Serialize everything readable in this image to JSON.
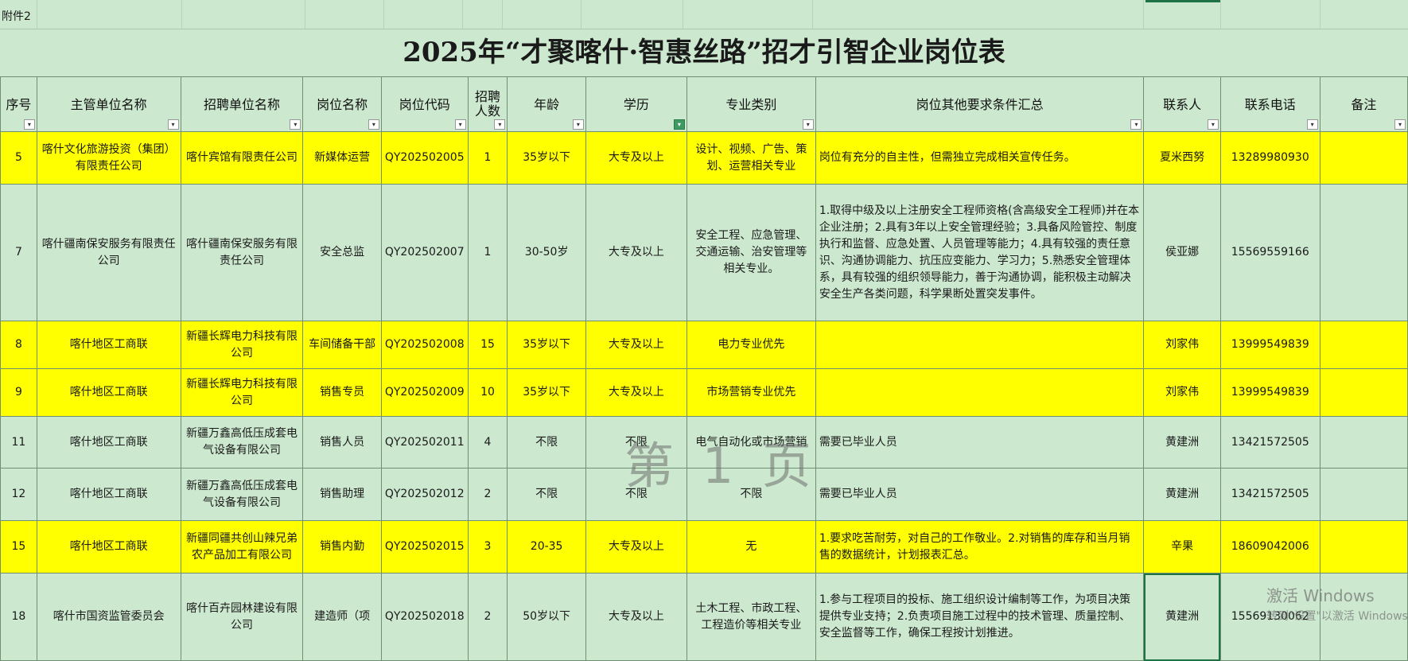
{
  "sheet": {
    "attachment_label": "附件2",
    "title": "2025年“才聚喀什·智惠丝路”招才引智企业岗位表"
  },
  "columns": [
    "序号",
    "主管单位名称",
    "招聘单位名称",
    "岗位名称",
    "岗位代码",
    "招聘人数",
    "年龄",
    "学历",
    "专业类别",
    "岗位其他要求条件汇总",
    "联系人",
    "联系电话",
    "备注"
  ],
  "rows": [
    {
      "no": "5",
      "org": "喀什文化旅游投资（集团）有限责任公司",
      "unit": "喀什宾馆有限责任公司",
      "post": "新媒体运营",
      "code": "QY202502005",
      "count": "1",
      "age": "35岁以下",
      "edu": "大专及以上",
      "major": "设计、视频、广告、策划、运营相关专业",
      "req": "岗位有充分的自主性，但需独立完成相关宣传任务。",
      "contact": "夏米西努",
      "phone": "13289980930",
      "note": ""
    },
    {
      "no": "7",
      "org": "喀什疆南保安服务有限责任公司",
      "unit": "喀什疆南保安服务有限责任公司",
      "post": "安全总监",
      "code": "QY202502007",
      "count": "1",
      "age": "30-50岁",
      "edu": "大专及以上",
      "major": "安全工程、应急管理、交通运输、治安管理等相关专业。",
      "req": "1.取得中级及以上注册安全工程师资格(含高级安全工程师)并在本企业注册；2.具有3年以上安全管理经验；3.具备风险管控、制度执行和监督、应急处置、人员管理等能力；4.具有较强的责任意识、沟通协调能力、抗压应变能力、学习力；5.熟悉安全管理体系，具有较强的组织领导能力，善于沟通协调，能积极主动解决安全生产各类问题，科学果断处置突发事件。",
      "contact": "侯亚娜",
      "phone": "15569559166",
      "note": ""
    },
    {
      "no": "8",
      "org": "喀什地区工商联",
      "unit": "新疆长辉电力科技有限公司",
      "post": "车间储备干部",
      "code": "QY202502008",
      "count": "15",
      "age": "35岁以下",
      "edu": "大专及以上",
      "major": "电力专业优先",
      "req": "",
      "contact": "刘家伟",
      "phone": "13999549839",
      "note": ""
    },
    {
      "no": "9",
      "org": "喀什地区工商联",
      "unit": "新疆长辉电力科技有限公司",
      "post": "销售专员",
      "code": "QY202502009",
      "count": "10",
      "age": "35岁以下",
      "edu": "大专及以上",
      "major": "市场营销专业优先",
      "req": "",
      "contact": "刘家伟",
      "phone": "13999549839",
      "note": ""
    },
    {
      "no": "11",
      "org": "喀什地区工商联",
      "unit": "新疆万鑫高低压成套电气设备有限公司",
      "post": "销售人员",
      "code": "QY202502011",
      "count": "4",
      "age": "不限",
      "edu": "不限",
      "major": "电气自动化或市场营销",
      "req": "需要已毕业人员",
      "contact": "黄建洲",
      "phone": "13421572505",
      "note": ""
    },
    {
      "no": "12",
      "org": "喀什地区工商联",
      "unit": "新疆万鑫高低压成套电气设备有限公司",
      "post": "销售助理",
      "code": "QY202502012",
      "count": "2",
      "age": "不限",
      "edu": "不限",
      "major": "不限",
      "req": "需要已毕业人员",
      "contact": "黄建洲",
      "phone": "13421572505",
      "note": ""
    },
    {
      "no": "15",
      "org": "喀什地区工商联",
      "unit": "新疆同疆共创山辣兄弟农产品加工有限公司",
      "post": "销售内勤",
      "code": "QY202502015",
      "count": "3",
      "age": "20-35",
      "edu": "大专及以上",
      "major": "无",
      "req": "1.要求吃苦耐劳，对自己的工作敬业。2.对销售的库存和当月销售的数据统计，计划报表汇总。",
      "contact": "辛果",
      "phone": "18609042006",
      "note": ""
    },
    {
      "no": "18",
      "org": "喀什市国资监管委员会",
      "unit": "喀什百卉园林建设有限公司",
      "post": "建造师（项",
      "code": "QY202502018",
      "count": "2",
      "age": "50岁以下",
      "edu": "大专及以上",
      "major": "土木工程、市政工程、工程造价等相关专业",
      "req": "1.参与工程项目的投标、施工组织设计编制等工作，为项目决策提供专业支持；2.负责项目施工过程中的技术管理、质量控制、安全监督等工作，确保工程按计划推进。",
      "contact": "黄建洲",
      "phone": "15569130062",
      "note": ""
    }
  ],
  "overlay": {
    "page_watermark": "第 1 页",
    "activate_title": "激活 Windows",
    "activate_sub": "转到\"设置\"以激活 Windows"
  }
}
